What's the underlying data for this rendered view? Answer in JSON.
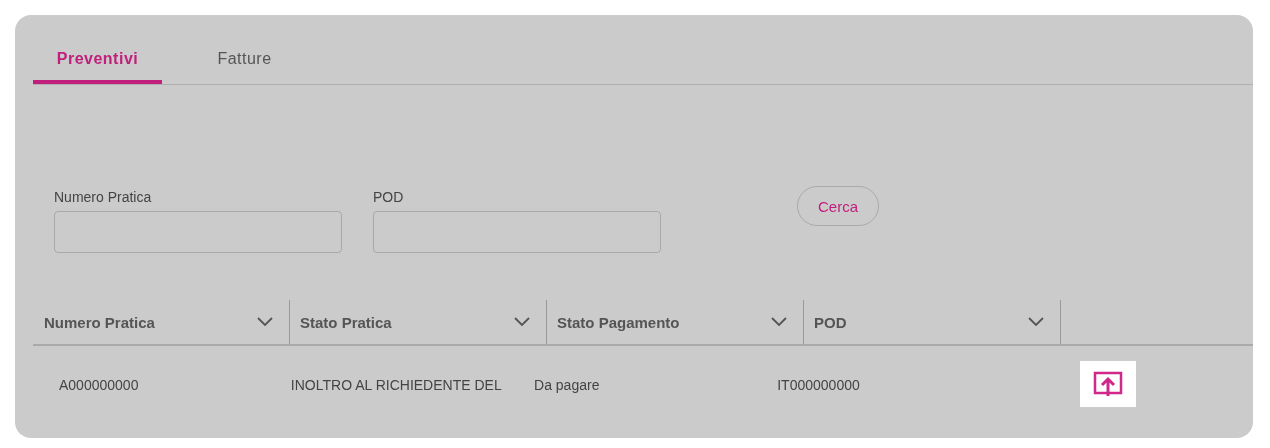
{
  "tabs": [
    {
      "label": "Preventivi",
      "selected": true
    },
    {
      "label": "Fatture",
      "selected": false
    }
  ],
  "filters": [
    {
      "label": "Numero Pratica"
    },
    {
      "label": "POD"
    }
  ],
  "search_button": "Cerca",
  "table": {
    "columns": [
      "Numero Pratica",
      "Stato Pratica",
      "Stato Pagamento",
      "POD"
    ],
    "rows": [
      {
        "cells": [
          "A000000000",
          "INOLTRO AL RICHIEDENTE DEL",
          "Da pagare",
          "IT000000000"
        ]
      }
    ]
  }
}
